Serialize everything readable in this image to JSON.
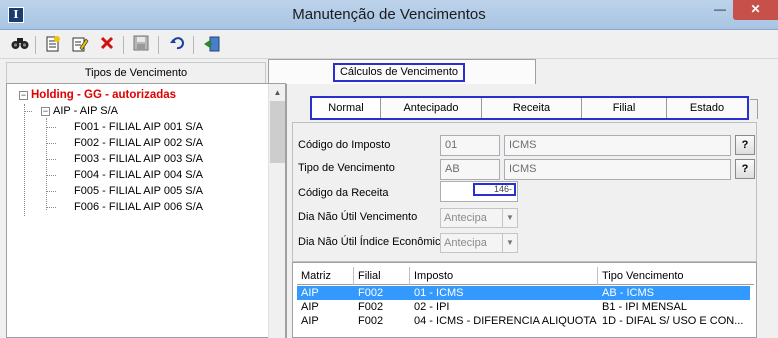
{
  "window": {
    "title": "Manutenção de Vencimentos",
    "app_icon": "I",
    "minimize": "—",
    "close": "✕"
  },
  "toolbar": {
    "icons": [
      "binoculars-icon",
      "new-doc-icon",
      "edit-icon",
      "delete-icon",
      "save-icon",
      "undo-icon",
      "exit-icon"
    ]
  },
  "tabs": {
    "left": "Tipos de Vencimento",
    "right": "Cálculos de Vencimento"
  },
  "tree": {
    "root": "Holding -  GG -  autorizadas",
    "company": "AIP - AIP S/A",
    "branches": [
      "F001 - FILIAL AIP 001 S/A",
      "F002 - FILIAL AIP 002 S/A",
      "F003 - FILIAL AIP 003 S/A",
      "F004 - FILIAL AIP 004 S/A",
      "F005 - FILIAL AIP 005 S/A",
      "F006 - FILIAL AIP 006 S/A"
    ]
  },
  "subtabs": [
    "Normal",
    "Antecipado",
    "Receita",
    "Filial",
    "Estado"
  ],
  "form": {
    "codigo_imposto_label": "Código do Imposto",
    "codigo_imposto_code": "01",
    "codigo_imposto_desc": "ICMS",
    "tipo_venc_label": "Tipo de Vencimento",
    "tipo_venc_code": "AB",
    "tipo_venc_desc": "ICMS",
    "codigo_receita_label": "Código da Receita",
    "codigo_receita_value": "146-",
    "dia_nao_util_label": "Dia Não Útil Vencimento",
    "dia_nao_util_value": "Antecipa",
    "dia_indice_label": "Dia Não Útil Índice Econômico",
    "dia_indice_value": "Antecipa",
    "lookup_btn": "?"
  },
  "grid": {
    "columns": [
      "Matriz",
      "Filial",
      "Imposto",
      "Tipo Vencimento"
    ],
    "rows": [
      [
        "AIP",
        "F002",
        "01 - ICMS",
        "AB - ICMS"
      ],
      [
        "AIP",
        "F002",
        "02 - IPI",
        "B1 - IPI MENSAL"
      ],
      [
        "AIP",
        "F002",
        "04 - ICMS - DIFERENCIA ALIQUOTA",
        "1D - DIFAL S/ USO E CON..."
      ]
    ],
    "selected_row": 0
  },
  "colors": {
    "highlight": "#2a2fd0",
    "root_text": "#e00000",
    "selection": "#3399ff"
  }
}
